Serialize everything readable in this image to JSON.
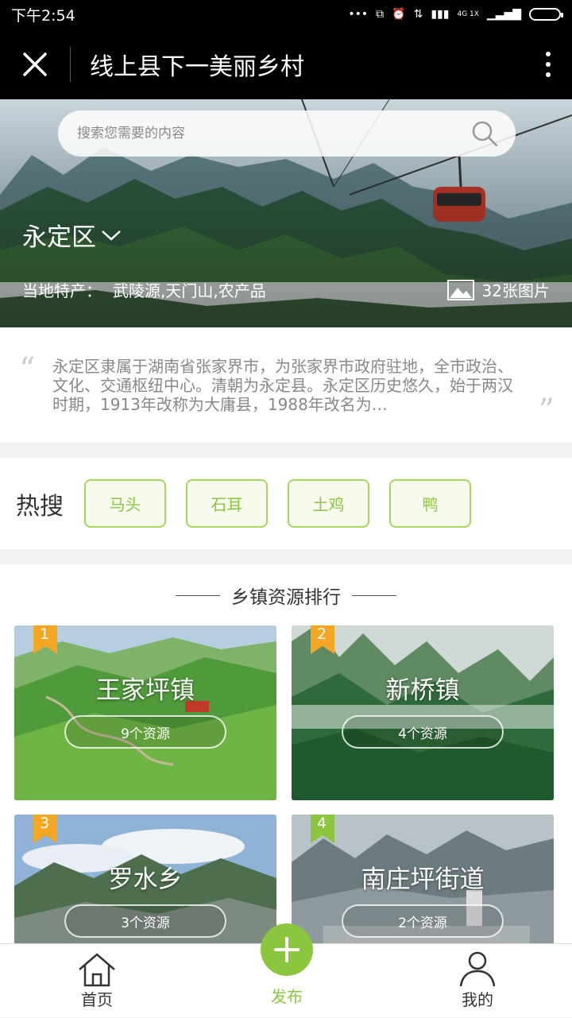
{
  "status_bar": {
    "time": "下午2:54",
    "network": "4G 1X"
  },
  "app_bar": {
    "title": "线上县下一美丽乡村"
  },
  "hero": {
    "search_placeholder": "搜索您需要的内容",
    "district": "永定区",
    "specialty_label": "当地特产：",
    "specialty_value": "武陵源,天门山,农产品",
    "photo_count": "32张图片"
  },
  "intro": {
    "text": "永定区隶属于湖南省张家界市，为张家界市政府驻地，全市政治、文化、交通枢纽中心。清朝为永定县。永定区历史悠久，始于两汉时期，1913年改称为大庸县，1988年改名为…"
  },
  "hot_search": {
    "label": "热搜",
    "tags": [
      "马头",
      "石耳",
      "土鸡",
      "鸭"
    ]
  },
  "ranking": {
    "title": "乡镇资源排行",
    "items": [
      {
        "rank": "1",
        "name": "王家坪镇",
        "resources": "9个资源",
        "badge_color": "#f5a623"
      },
      {
        "rank": "2",
        "name": "新桥镇",
        "resources": "4个资源",
        "badge_color": "#f5a623"
      },
      {
        "rank": "3",
        "name": "罗水乡",
        "resources": "3个资源",
        "badge_color": "#f5a623"
      },
      {
        "rank": "4",
        "name": "南庄坪街道",
        "resources": "2个资源",
        "badge_color": "#8cc63f"
      }
    ]
  },
  "bottom_nav": {
    "home": "首页",
    "publish": "发布",
    "mine": "我的"
  },
  "colors": {
    "accent": "#8cc63f",
    "rank_badge": "#f5a623"
  }
}
